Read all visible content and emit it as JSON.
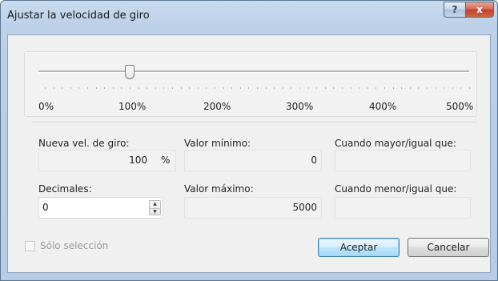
{
  "window": {
    "title": "Ajustar la velocidad de giro",
    "help_label": "?",
    "close_label": "x"
  },
  "slider": {
    "value_percent": 100,
    "min_percent": 0,
    "max_percent": 500,
    "tick_labels": [
      "0%",
      "100%",
      "200%",
      "300%",
      "400%",
      "500%"
    ]
  },
  "fields": {
    "new_speed": {
      "label": "Nueva vel. de giro:",
      "value": "100",
      "unit": "%"
    },
    "min_value": {
      "label": "Valor mínimo:",
      "value": "0"
    },
    "when_greater": {
      "label": "Cuando mayor/igual que:",
      "value": ""
    },
    "decimals": {
      "label": "Decimales:",
      "value": "0",
      "spin_up": "▲",
      "spin_down": "▼"
    },
    "max_value": {
      "label": "Valor máximo:",
      "value": "5000"
    },
    "when_less": {
      "label": "Cuando menor/igual que:",
      "value": ""
    }
  },
  "selection_only": {
    "label": "Sólo selección",
    "checked": false
  },
  "buttons": {
    "ok": "Aceptar",
    "cancel": "Cancelar"
  },
  "colors": {
    "title_bar": "#bcd1e8",
    "close_button": "#c2412a",
    "default_button_border": "#3c7fb1"
  }
}
